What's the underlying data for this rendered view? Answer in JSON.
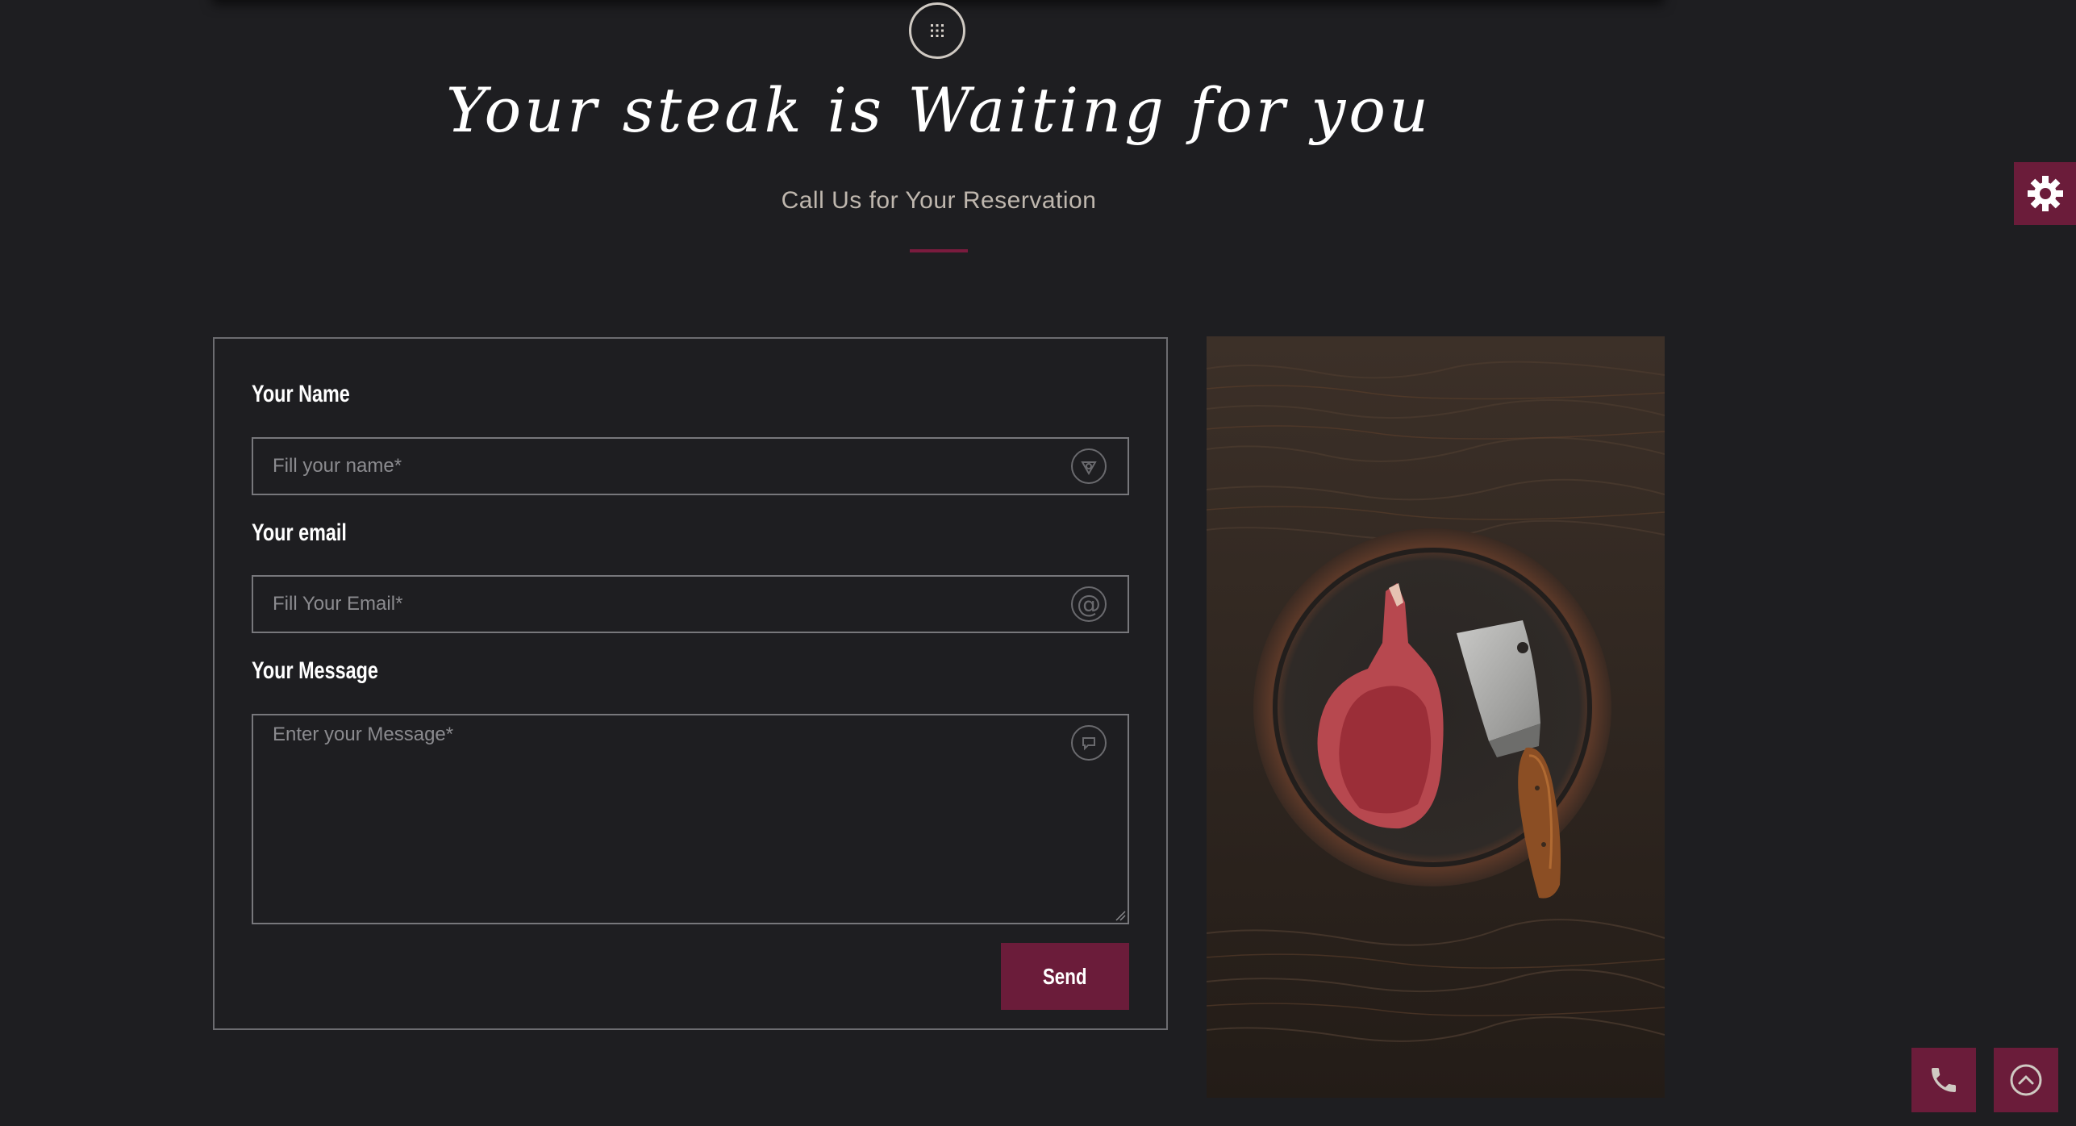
{
  "heading": {
    "title": "Your steak is Waiting for you",
    "subtitle": "Call Us for Your Reservation"
  },
  "form": {
    "name_label": "Your Name",
    "name_placeholder": "Fill your name*",
    "email_label": "Your email",
    "email_placeholder": "Fill Your Email*",
    "message_label": "Your Message",
    "message_placeholder": "Enter your Message*",
    "send_label": "Send"
  },
  "icons": {
    "menu": "grid-dots-icon",
    "name_field": "user-icon",
    "email_field": "at-sign-icon",
    "message_field": "chat-bubble-icon",
    "settings": "gear-icon",
    "phone": "phone-icon",
    "scroll_top": "chevron-up-circle-icon"
  },
  "colors": {
    "background": "#1e1e21",
    "accent": "#6b1c3a",
    "subtitle": "#bfb7ae"
  }
}
